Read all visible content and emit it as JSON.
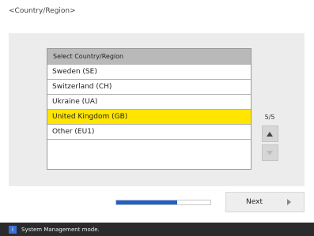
{
  "page": {
    "title": "<Country/Region>"
  },
  "list": {
    "header": "Select Country/Region",
    "rows": [
      {
        "label": "Sweden (SE)",
        "selected": false
      },
      {
        "label": "Switzerland (CH)",
        "selected": false
      },
      {
        "label": "Ukraine (UA)",
        "selected": false
      },
      {
        "label": "United Kingdom (GB)",
        "selected": true
      },
      {
        "label": "Other (EU1)",
        "selected": false
      }
    ]
  },
  "pager": {
    "count": "5/5",
    "up_icon": "triangle-up",
    "down_icon": "triangle-down"
  },
  "progress": {
    "fraction": 0.65,
    "color": "#1f5fc8"
  },
  "footer": {
    "next_label": "Next",
    "next_icon": "arrow-right"
  },
  "status": {
    "icon_label": "i",
    "text": "System Management mode."
  },
  "colors": {
    "selected": "#ffe500",
    "header": "#b9b9b9",
    "panel": "#ececec"
  }
}
